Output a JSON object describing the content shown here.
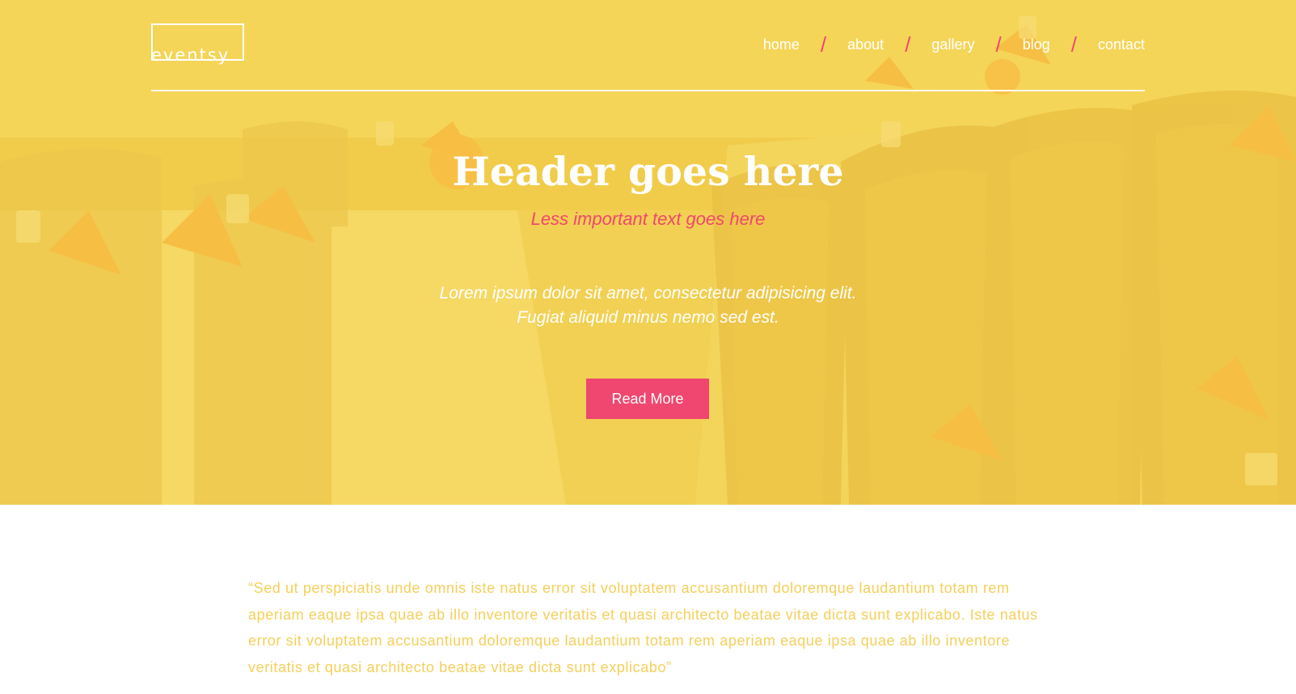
{
  "brand": {
    "logo_text": "eventsy"
  },
  "nav": {
    "items": [
      {
        "label": "home"
      },
      {
        "label": "about"
      },
      {
        "label": "gallery"
      },
      {
        "label": "blog"
      },
      {
        "label": "contact"
      }
    ],
    "separator": "/"
  },
  "hero": {
    "title": "Header goes here",
    "subtitle": "Less important text goes here",
    "description_line1": "Lorem ipsum dolor sit amet, consectetur adipisicing elit.",
    "description_line2": "Fugiat aliquid minus nemo sed est.",
    "button_label": "Read More",
    "background_image": "banquet-tables-chairs"
  },
  "quote": {
    "text": "“Sed ut perspiciatis unde omnis iste natus error sit voluptatem accusantium doloremque laudantium totam rem aperiam eaque ipsa quae ab illo inventore veritatis et quasi architecto beatae vitae dicta sunt explicabo. Iste natus error sit voluptatem accusantium doloremque laudantium totam rem aperiam eaque ipsa quae ab illo inventore veritatis et quasi architecto beatae vitae dicta sunt explicabo”"
  },
  "colors": {
    "accent": "#ef476f",
    "hero_overlay": "#f7d64c",
    "quote_text": "#f5cf5a",
    "white": "#ffffff"
  }
}
